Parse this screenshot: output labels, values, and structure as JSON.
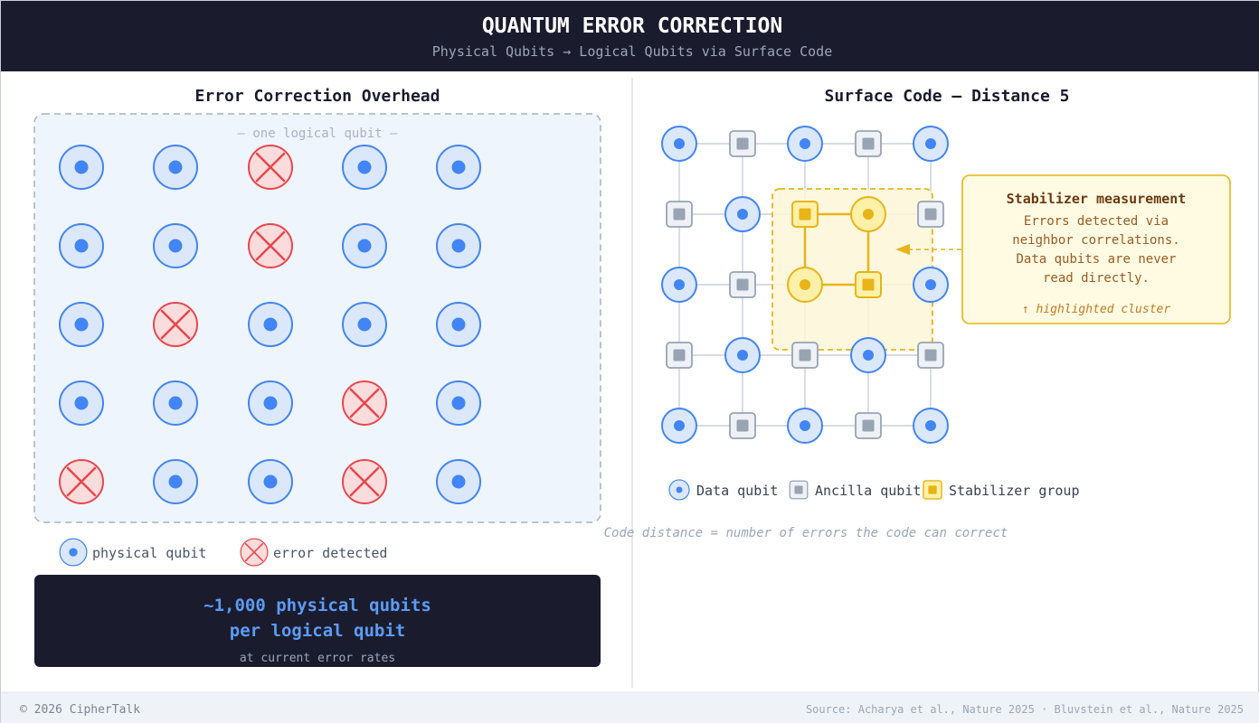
{
  "header": {
    "title": "QUANTUM ERROR CORRECTION",
    "subtitle": "Physical Qubits → Logical Qubits via Surface Code"
  },
  "left": {
    "heading": "Error Correction Overhead",
    "group_label": "— one logical qubit —",
    "grid": [
      [
        "physical",
        "physical",
        "error",
        "physical",
        "physical"
      ],
      [
        "physical",
        "physical",
        "error",
        "physical",
        "physical"
      ],
      [
        "physical",
        "error",
        "physical",
        "physical",
        "physical"
      ],
      [
        "physical",
        "physical",
        "physical",
        "error",
        "physical"
      ],
      [
        "error",
        "physical",
        "physical",
        "error",
        "physical"
      ]
    ],
    "legend": {
      "physical": "physical qubit",
      "error": "error detected"
    },
    "banner": {
      "line1": "~1,000 physical qubits",
      "line2": "per logical qubit",
      "note": "at current error rates"
    }
  },
  "right": {
    "heading": "Surface Code — Distance 5",
    "lattice": [
      [
        "data",
        "ancilla",
        "data",
        "ancilla",
        "data"
      ],
      [
        "ancilla",
        "data",
        "stab-ancilla",
        "stab-data",
        "ancilla"
      ],
      [
        "data",
        "ancilla",
        "stab-data",
        "stab-ancilla",
        "data"
      ],
      [
        "ancilla",
        "data",
        "ancilla",
        "data",
        "ancilla"
      ],
      [
        "data",
        "ancilla",
        "data",
        "ancilla",
        "data"
      ]
    ],
    "callout": {
      "title": "Stabilizer measurement",
      "lines": [
        "Errors detected via",
        "neighbor correlations.",
        "Data qubits are never",
        "read directly."
      ],
      "tag": "↑ highlighted cluster"
    },
    "legend": {
      "data": "Data qubit",
      "ancilla": "Ancilla qubit",
      "stabilizer": "Stabilizer group"
    },
    "caption": "Code distance = number of errors the code can correct"
  },
  "footer": {
    "copyright": "© 2026 CipherTalk",
    "source": "Source: Acharya et al., Nature 2025 · Bluvstein et al., Nature 2025"
  },
  "colors": {
    "header_bg": "#1b1b2e",
    "qubit_blue": "#4285f4",
    "qubit_fill": "#dbe8fb",
    "error_red": "#e8474c",
    "error_fill": "#fbdcdc",
    "ancilla_gray": "#98a3b3",
    "stabilizer_gold": "#e8b417",
    "stabilizer_fill": "#fdf0a8",
    "group_bg": "#eff5fd"
  }
}
